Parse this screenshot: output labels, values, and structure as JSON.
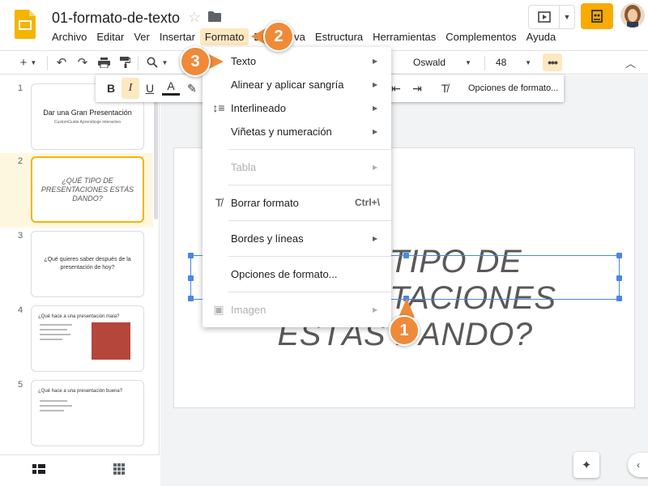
{
  "header": {
    "doc_title": "01-formato-de-texto",
    "menus": [
      "Archivo",
      "Editar",
      "Ver",
      "Insertar",
      "Formato",
      "Diapositiva",
      "Estructura",
      "Herramientas",
      "Complementos",
      "Ayuda"
    ],
    "active_menu": "Formato"
  },
  "toolbar": {
    "font": "Oswald",
    "font_size": "48",
    "more_label": "•••"
  },
  "overflow_toolbar": {
    "bold": "B",
    "italic": "I",
    "underline": "U",
    "text_color": "A",
    "format_options": "Opciones de formato..."
  },
  "format_menu": {
    "items": [
      {
        "label": "Texto",
        "submenu": true,
        "disabled": false
      },
      {
        "label": "Alinear y aplicar sangría",
        "submenu": true,
        "disabled": false
      },
      {
        "label": "Interlineado",
        "submenu": true,
        "disabled": false,
        "icon": "line-spacing-icon"
      },
      {
        "label": "Viñetas y numeración",
        "submenu": true,
        "disabled": false
      },
      {
        "label": "Tabla",
        "submenu": true,
        "disabled": true
      },
      {
        "label": "Borrar formato",
        "shortcut": "Ctrl+\\",
        "disabled": false,
        "icon": "clear-formatting-icon"
      },
      {
        "label": "Bordes y líneas",
        "submenu": true,
        "disabled": false
      },
      {
        "label": "Opciones de formato...",
        "disabled": false
      },
      {
        "label": "Imagen",
        "submenu": true,
        "disabled": true,
        "icon": "image-icon"
      }
    ]
  },
  "filmstrip": {
    "slides": [
      {
        "num": "1",
        "title": "Dar una Gran Presentación",
        "subtitle": "CustomGuide Aprendizaje interactivo"
      },
      {
        "num": "2",
        "title": "¿QUÉ TIPO DE PRESENTACIONES ESTÁS DANDO?"
      },
      {
        "num": "3",
        "title": "¿Qué quieres saber después de la presentación de hoy?"
      },
      {
        "num": "4",
        "title": "¿Qué hace a una presentación mala?"
      },
      {
        "num": "5",
        "title": "¿Qué hace a una presentación buena?"
      }
    ]
  },
  "slide": {
    "title_line1": "¿QUÉ TIPO DE PRESENTACIONES",
    "title_line2": "ESTÁS DANDO?"
  },
  "callouts": [
    "1",
    "2",
    "3"
  ],
  "colors": {
    "accent": "#ef8a38",
    "selection": "#4a86e8",
    "highlight": "#fde8c0"
  }
}
